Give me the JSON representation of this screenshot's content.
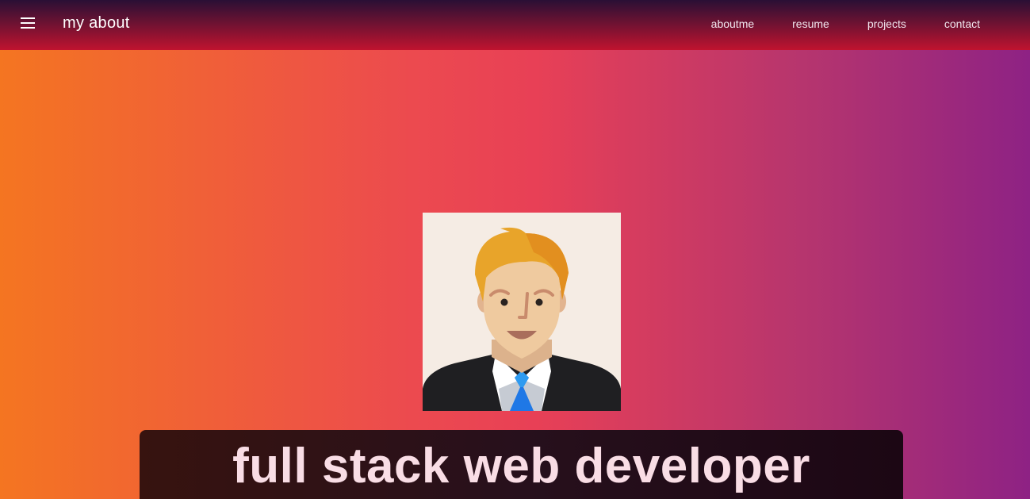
{
  "header": {
    "brand": "my about",
    "nav": [
      "aboutme",
      "resume",
      "projects",
      "contact"
    ]
  },
  "hero": {
    "headline": "full stack web developer"
  },
  "icons": {
    "menu": "menu-icon",
    "avatar": "avatar-illustration"
  },
  "colors": {
    "gradient_left": "#f47521",
    "gradient_mid": "#e84056",
    "gradient_right": "#8e2284",
    "topbar_top": "#2a0f35",
    "topbar_bottom": "#c0132f",
    "headline_text": "#f9dde5",
    "headline_bg": "#27101c"
  }
}
